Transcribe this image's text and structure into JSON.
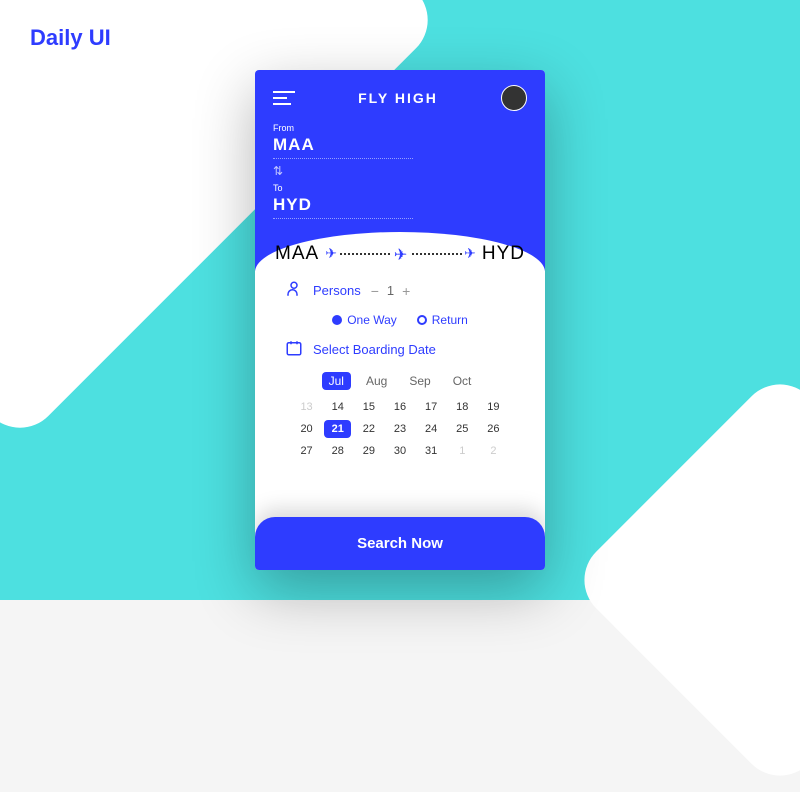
{
  "brand": {
    "a": "Daily",
    "b": "UI"
  },
  "header": {
    "title": "FLY HIGH",
    "from_label": "From",
    "from": "MAA",
    "to_label": "To",
    "to": "HYD"
  },
  "route": {
    "from": "MAA",
    "to": "HYD"
  },
  "persons": {
    "label": "Persons",
    "count": "1"
  },
  "trip": {
    "oneway": "One Way",
    "return": "Return"
  },
  "date": {
    "label": "Select Boarding Date",
    "months": [
      "Jul",
      "Aug",
      "Sep",
      "Oct"
    ],
    "days": [
      {
        "n": "13",
        "dim": true
      },
      {
        "n": "14"
      },
      {
        "n": "15"
      },
      {
        "n": "16"
      },
      {
        "n": "17"
      },
      {
        "n": "18"
      },
      {
        "n": "19"
      },
      {
        "n": "20"
      },
      {
        "n": "21",
        "sel": true
      },
      {
        "n": "22"
      },
      {
        "n": "23"
      },
      {
        "n": "24"
      },
      {
        "n": "25"
      },
      {
        "n": "26"
      },
      {
        "n": "27"
      },
      {
        "n": "28"
      },
      {
        "n": "29"
      },
      {
        "n": "30"
      },
      {
        "n": "31"
      },
      {
        "n": "1",
        "dim": true
      },
      {
        "n": "2",
        "dim": true
      }
    ]
  },
  "cta": "Search Now"
}
